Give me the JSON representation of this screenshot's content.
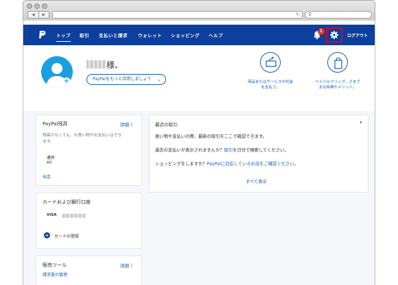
{
  "nav": {
    "items": [
      "トップ",
      "取引",
      "支払いと請求",
      "ウォレット",
      "ショッピング",
      "ヘルプ"
    ],
    "badge_count": "1",
    "logout": "ログアウト"
  },
  "profile": {
    "name_suffix": "様、",
    "more_button": "PayPalをもっと活用しましょう",
    "quick_actions": [
      {
        "label_line1": "商品またはサービスの代金",
        "label_line2": "を支払う。",
        "icon": "send-money-icon"
      },
      {
        "label_line1": "ペイパルクリップ。さまざ",
        "label_line2": "まな特典やメリット。",
        "icon": "shopping-bag-icon"
      }
    ]
  },
  "balance_card": {
    "title": "PayPal残高",
    "details": "詳細 〉",
    "note_line1": "残高がなくても、お買い物やお支払いはでき",
    "note_line2": "ます。",
    "currency_label": "通貨",
    "amount": "¥0",
    "withdraw": "出金"
  },
  "bank_card": {
    "title": "カードおよび銀行口座",
    "card_brand": "VISA",
    "add_card": "カードの登録"
  },
  "sales_card": {
    "title": "販売ツール",
    "details": "詳細 〉",
    "link": "請求書の管理"
  },
  "recent_card": {
    "title": "最近の取引",
    "line1": "買い物や支払いの際、最新の取引をここで確認できます。",
    "line2_a": "過去の支払いが表示されませんか？",
    "line2_link": "取引",
    "line2_b": "を日付で検索してください。",
    "line3_a": "ショッピングをしますか？",
    "line3_link": "PayPalに対応しているお店をご確認ください。",
    "show_all": "すべて表示"
  },
  "colors": {
    "nav_bg": "#0d3f9f",
    "accent": "#0d5fb0",
    "highlight": "#e2001a",
    "avatar": "#1a9fe0"
  }
}
